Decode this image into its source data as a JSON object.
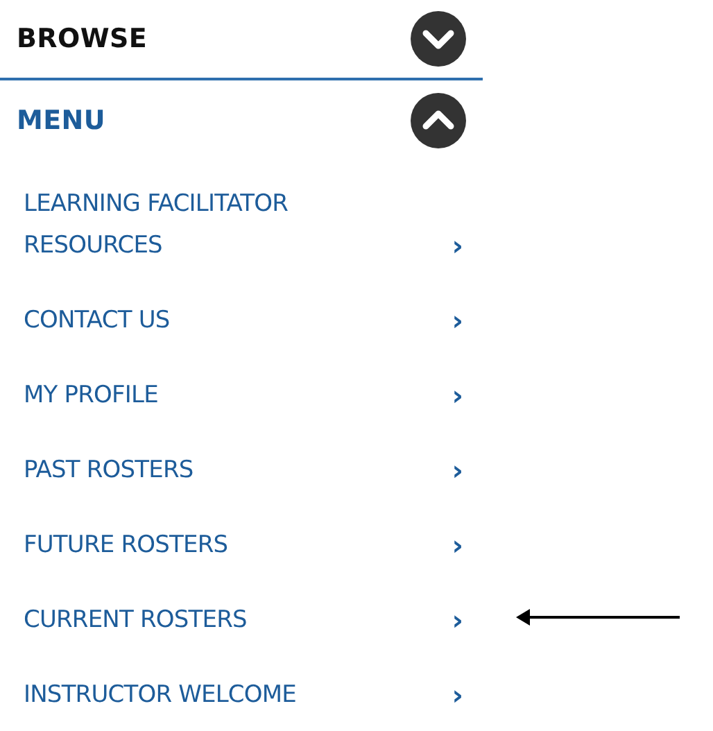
{
  "sections": [
    {
      "title": "BROWSE",
      "expanded": false
    },
    {
      "title": "MENU",
      "expanded": true
    }
  ],
  "menu_items": [
    {
      "label": "LEARNING FACILITATOR RESOURCES",
      "arrow_pointer": false
    },
    {
      "label": "CONTACT US",
      "arrow_pointer": false
    },
    {
      "label": "MY PROFILE",
      "arrow_pointer": false
    },
    {
      "label": "PAST ROSTERS",
      "arrow_pointer": false
    },
    {
      "label": "FUTURE ROSTERS",
      "arrow_pointer": false
    },
    {
      "label": "CURRENT ROSTERS",
      "arrow_pointer": true
    },
    {
      "label": "INSTRUCTOR WELCOME",
      "arrow_pointer": false
    }
  ],
  "chevron": "›"
}
